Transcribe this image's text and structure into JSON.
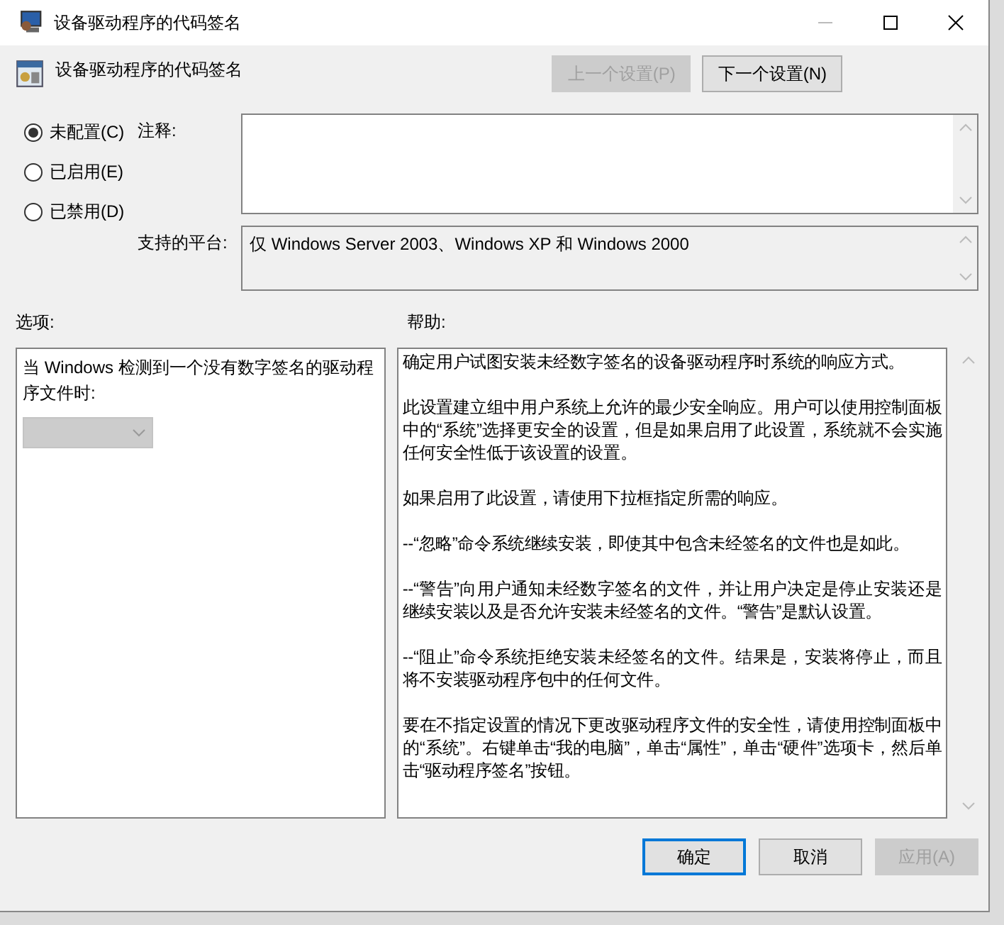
{
  "window": {
    "title": "设备驱动程序的代码签名"
  },
  "header": {
    "title": "设备驱动程序的代码签名",
    "buttons": [
      {
        "label": "上一个设置(P)",
        "disabled": true
      },
      {
        "label": "下一个设置(N)",
        "disabled": false
      }
    ]
  },
  "state_options": [
    {
      "label": "未配置(C)",
      "selected": true
    },
    {
      "label": "已启用(E)",
      "selected": false
    },
    {
      "label": "已禁用(D)",
      "selected": false
    }
  ],
  "comment": {
    "label": "注释:"
  },
  "platform": {
    "label": "支持的平台:",
    "value": "仅 Windows Server 2003、Windows XP 和 Windows 2000"
  },
  "options": {
    "label": "选项:",
    "prompt": "当 Windows 检测到一个没有数字签名的驱动程序文件时:",
    "dropdown": {
      "disabled": true
    }
  },
  "help": {
    "label": "帮助:",
    "paragraphs": [
      "确定用户试图安装未经数字签名的设备驱动程序时系统的响应方式。",
      "此设置建立组中用户系统上允许的最少安全响应。用户可以使用控制面板中的“系统”选择更安全的设置，但是如果启用了此设置，系统就不会实施任何安全性低于该设置的设置。",
      "如果启用了此设置，请使用下拉框指定所需的响应。",
      "--“忽略”命令系统继续安装，即使其中包含未经签名的文件也是如此。",
      "--“警告”向用户通知未经数字签名的文件，并让用户决定是停止安装还是继续安装以及是否允许安装未经签名的文件。“警告”是默认设置。",
      "--“阻止”命令系统拒绝安装未经签名的文件。结果是，安装将停止，而且将不安装驱动程序包中的任何文件。",
      "要在不指定设置的情况下更改驱动程序文件的安全性，请使用控制面板中的“系统”。右键单击“我的电脑”，单击“属性”，单击“硬件”选项卡，然后单击“驱动程序签名”按钮。"
    ]
  },
  "footer_buttons": [
    {
      "label": "确定",
      "selected": true,
      "disabled": false
    },
    {
      "label": "取消",
      "selected": false,
      "disabled": false
    },
    {
      "label": "应用(A)",
      "selected": false,
      "disabled": true
    }
  ]
}
